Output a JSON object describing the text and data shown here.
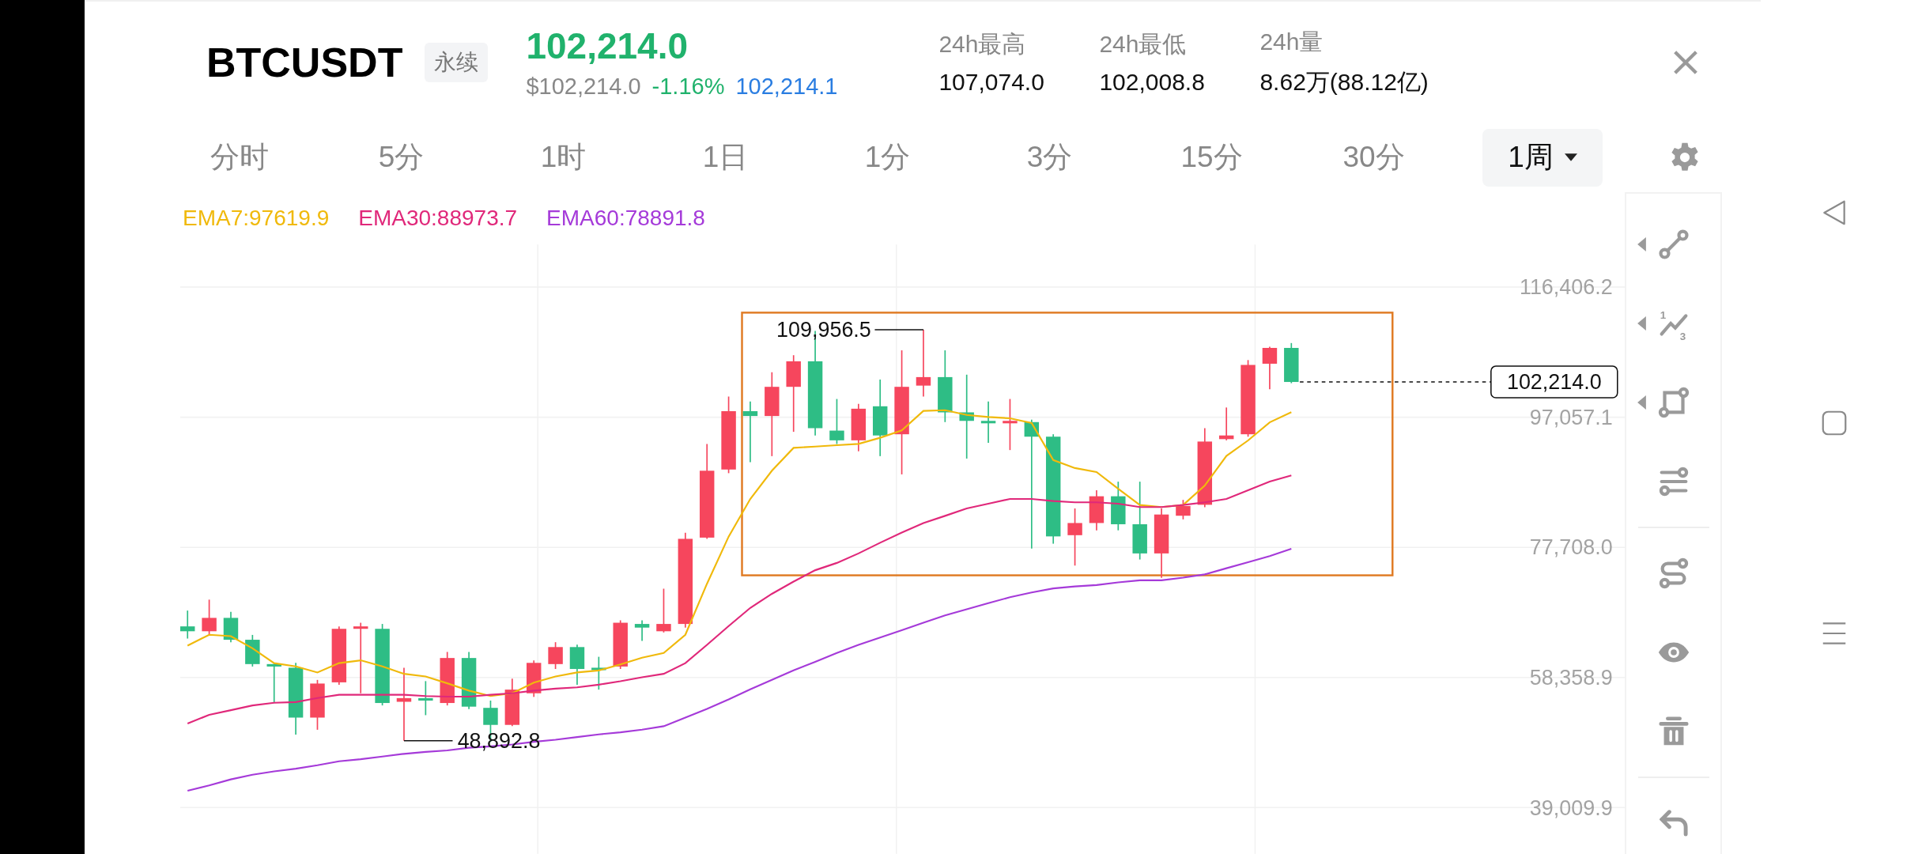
{
  "header": {
    "symbol": "BTCUSDT",
    "contract_badge": "永续",
    "last_price": "102,214.0",
    "usd_price": "$102,214.0",
    "change": "-1.16%",
    "mark_price": "102,214.1",
    "stats": [
      {
        "label": "24h最高",
        "value": "107,074.0"
      },
      {
        "label": "24h最低",
        "value": "102,008.8"
      },
      {
        "label": "24h量",
        "value": "8.62万(88.12亿)"
      }
    ]
  },
  "intervals": [
    {
      "label": "分时",
      "kind": "tab",
      "selected": false
    },
    {
      "label": "5分",
      "kind": "tab",
      "selected": false
    },
    {
      "label": "1时",
      "kind": "tab",
      "selected": false
    },
    {
      "label": "1日",
      "kind": "tab",
      "selected": false
    },
    {
      "label": "1分",
      "kind": "tab",
      "selected": false
    },
    {
      "label": "3分",
      "kind": "tab",
      "selected": false
    },
    {
      "label": "15分",
      "kind": "tab",
      "selected": false
    },
    {
      "label": "30分",
      "kind": "tab",
      "selected": false
    },
    {
      "label": "1周",
      "kind": "dropdown",
      "selected": true
    }
  ],
  "chart": {
    "chart_data": {
      "type": "line",
      "grid": true,
      "ylim": [
        39009.9,
        116406.2
      ],
      "yticks": [
        {
          "value": 116406.2,
          "label": "116,406.2"
        },
        {
          "value": 97057.1,
          "label": "97,057.1"
        },
        {
          "value": 77708.0,
          "label": "77,708.0"
        },
        {
          "value": 58358.9,
          "label": "58,358.9"
        },
        {
          "value": 39009.9,
          "label": "39,009.9"
        }
      ],
      "series": [
        {
          "name": "EMA7:97619.9",
          "color": "#f0b90b",
          "values": [
            63100,
            64700,
            64500,
            62700,
            60500,
            60000,
            59100,
            60500,
            60900,
            60000,
            58900,
            58500,
            57500,
            56400,
            55600,
            56000,
            57600,
            58500,
            59100,
            59400,
            60300,
            61300,
            62000,
            64700,
            72300,
            79300,
            84900,
            89100,
            92500,
            92700,
            92900,
            93100,
            94000,
            95100,
            98000,
            98100,
            97400,
            97100,
            96900,
            96200,
            90700,
            89500,
            88900,
            86400,
            84000,
            83700,
            84000,
            86900,
            91300,
            93600,
            96300,
            97800
          ]
        },
        {
          "name": "EMA30:88973.7",
          "color": "#e0287a",
          "values": [
            51500,
            52800,
            53500,
            54200,
            54600,
            54700,
            55300,
            55800,
            55800,
            55800,
            55800,
            55600,
            55500,
            55500,
            55800,
            56000,
            56400,
            56700,
            56900,
            57300,
            57800,
            58400,
            58900,
            60500,
            63200,
            66000,
            68700,
            70800,
            72600,
            74300,
            75400,
            76800,
            78400,
            79900,
            81300,
            82400,
            83500,
            84200,
            84900,
            84900,
            84600,
            84400,
            84400,
            84200,
            83700,
            83700,
            84000,
            84400,
            84900,
            86200,
            87500,
            88400
          ]
        },
        {
          "name": "EMA60:78891.8",
          "color": "#a53ad9",
          "values": [
            41500,
            42300,
            43200,
            43900,
            44400,
            44800,
            45300,
            45900,
            46200,
            46600,
            47000,
            47300,
            47500,
            47900,
            48100,
            48400,
            48800,
            49100,
            49500,
            49900,
            50200,
            50600,
            51100,
            52400,
            53700,
            55100,
            56600,
            58000,
            59400,
            60700,
            62000,
            63200,
            64300,
            65400,
            66500,
            67600,
            68500,
            69400,
            70300,
            71000,
            71600,
            71900,
            72100,
            72500,
            72800,
            72800,
            73200,
            73700,
            74600,
            75500,
            76400,
            77500
          ]
        }
      ],
      "annotations": [
        {
          "text": "109,956.5"
        },
        {
          "text": "48,892.8"
        },
        {
          "text": "102,214.0"
        }
      ]
    }
  },
  "drawing_tools": [
    [
      {
        "kind": "segment",
        "submenu": true
      },
      {
        "kind": "wave",
        "submenu": true,
        "labels": [
          "1",
          "3"
        ]
      },
      {
        "kind": "polygon",
        "submenu": true
      },
      {
        "kind": "sliders",
        "submenu": false
      }
    ],
    [
      {
        "kind": "path",
        "submenu": false
      },
      {
        "kind": "eye",
        "submenu": false
      },
      {
        "kind": "trash",
        "submenu": false
      }
    ],
    [
      {
        "kind": "undo",
        "submenu": false
      }
    ]
  ]
}
